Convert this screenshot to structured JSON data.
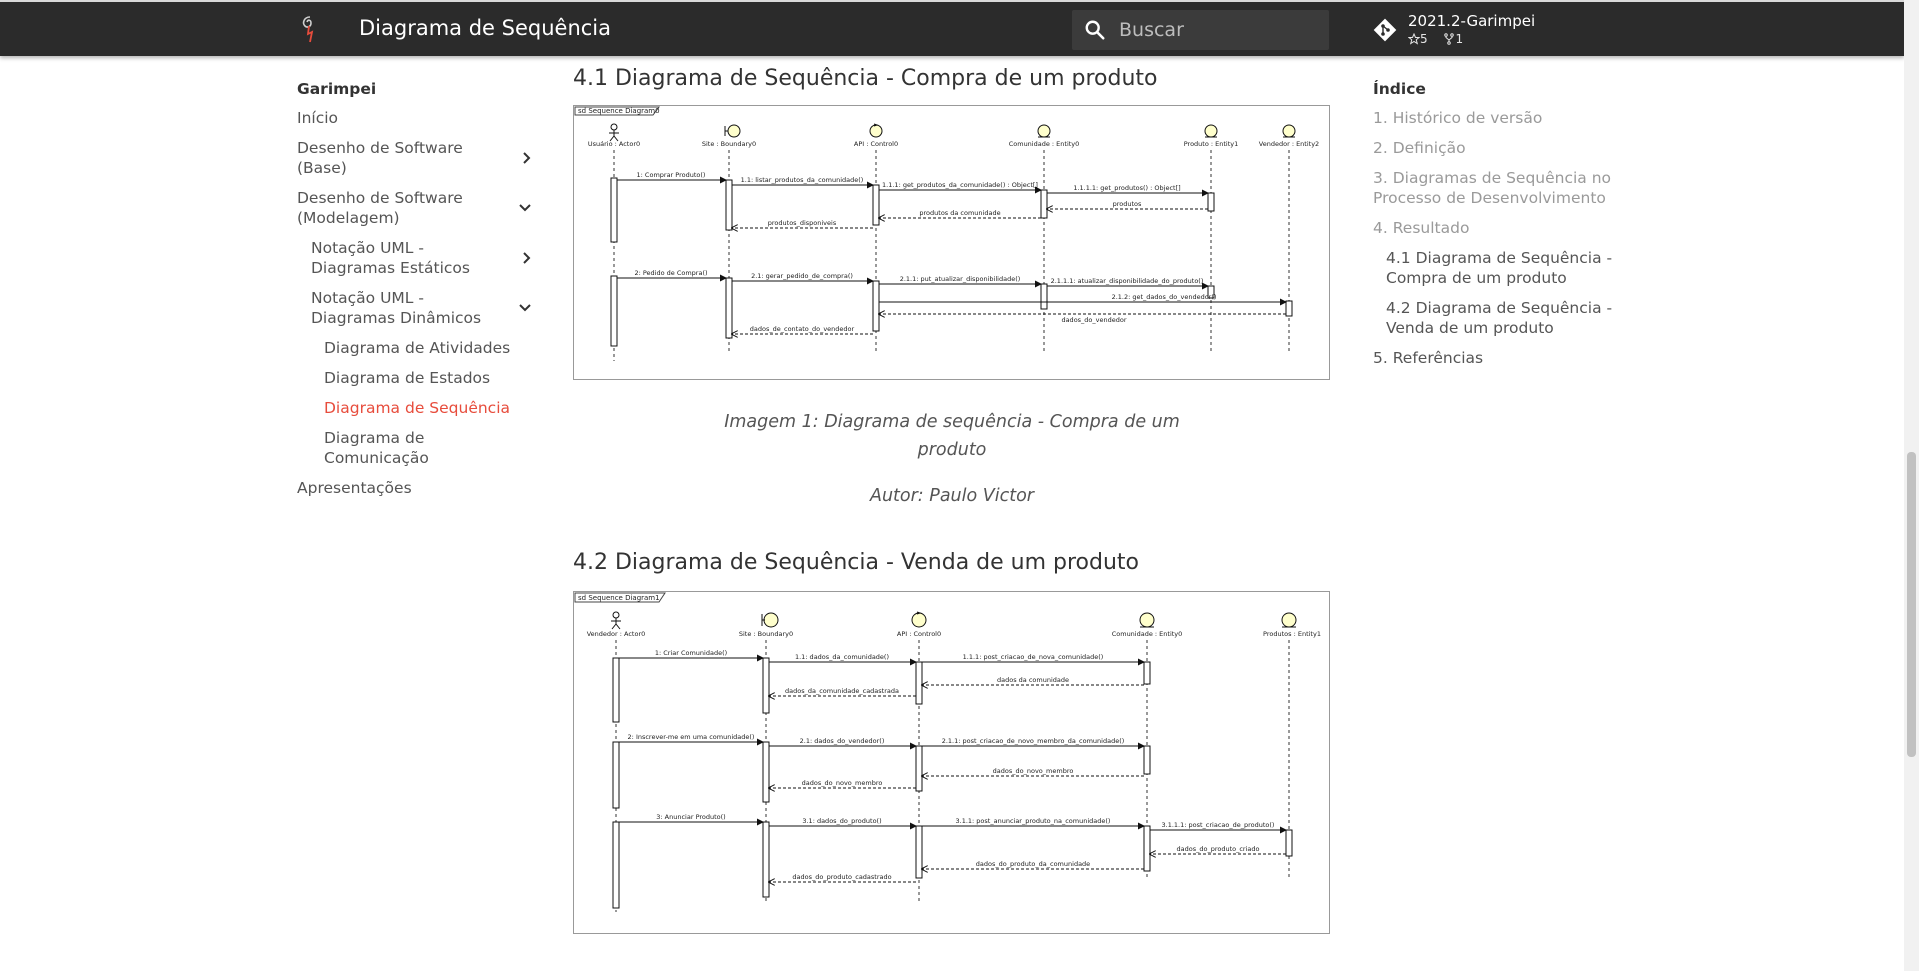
{
  "header": {
    "title": "Diagrama de Sequência",
    "search_placeholder": "Buscar",
    "repo_name": "2021.2-Garimpei",
    "stars": "5",
    "forks": "1"
  },
  "nav": {
    "brand": "Garimpei",
    "items": [
      {
        "label": "Início"
      },
      {
        "label": "Desenho de Software (Base)"
      },
      {
        "label": "Desenho de Software (Modelagem)"
      },
      {
        "label": "Notação UML - Diagramas Estáticos"
      },
      {
        "label": "Notação UML - Diagramas Dinâmicos"
      },
      {
        "label": "Diagrama de Atividades"
      },
      {
        "label": "Diagrama de Estados"
      },
      {
        "label": "Diagrama de Sequência"
      },
      {
        "label": "Diagrama de Comunicação"
      },
      {
        "label": "Apresentações"
      }
    ]
  },
  "main": {
    "section1_title": "4.1 Diagrama de Sequência - Compra de um produto",
    "caption1": "Imagem 1: Diagrama de sequência - Compra de um produto",
    "author1": "Autor: Paulo Victor",
    "section2_title": "4.2 Diagrama de Sequência - Venda de um produto"
  },
  "diagram1": {
    "frame": "sd Sequence Diagram0",
    "lifelines": [
      "Usuário : Actor0",
      "Site : Boundary0",
      "API : Control0",
      "Comunidade : Entity0",
      "Produto : Entity1",
      "Vendedor : Entity2"
    ],
    "messages": [
      "1: Comprar Produto()",
      "1.1: listar_produtos_da_comunidade()",
      "1.1.1: get_produtos_da_comunidade() : Object[]",
      "1.1.1.1: get_produtos() : Object[]",
      "produtos",
      "produtos da comunidade",
      "produtos_disponiveis",
      "2: Pedido de Compra()",
      "2.1: gerar_pedido_de_compra()",
      "2.1.1: put_atualizar_disponibilidade()",
      "2.1.1.1: atualizar_disponibilidade_do_produto()",
      "2.1.2: get_dados_do_vendedor()",
      "dados_do_vendedor",
      "dados_de_contato_do_vendedor"
    ]
  },
  "diagram2": {
    "frame": "sd Sequence Diagram1",
    "lifelines": [
      "Vendedor : Actor0",
      "Site : Boundary0",
      "API : Control0",
      "Comunidade : Entity0",
      "Produtos : Entity1"
    ],
    "messages": [
      "1: Criar Comunidade()",
      "1.1: dados_da_comunidade()",
      "1.1.1: post_criacao_de_nova_comunidade()",
      "dados da comunidade",
      "dados_da_comunidade_cadastrada",
      "2: Inscrever-me em uma comunidade()",
      "2.1: dados_do_vendedor()",
      "2.1.1: post_criacao_de_novo_membro_da_comunidade()",
      "dados_do_novo_membro",
      "dados_do_novo_membro",
      "3: Anunciar Produto()",
      "3.1: dados_do_produto()",
      "3.1.1: post_anunciar_produto_na_comunidade()",
      "3.1.1.1: post_criacao_de_produto()",
      "dados_do_produto_criado",
      "dados_do_produto_da_comunidade",
      "dados_do_produto_cadastrado"
    ]
  },
  "toc": {
    "title": "Índice",
    "items": [
      {
        "label": "1. Histórico de versão"
      },
      {
        "label": "2. Definição"
      },
      {
        "label": "3. Diagramas de Sequência no Processo de Desenvolvimento"
      },
      {
        "label": "4. Resultado"
      },
      {
        "label": "4.1 Diagrama de Sequência - Compra de um produto"
      },
      {
        "label": "4.2 Diagrama de Sequência - Venda de um produto"
      },
      {
        "label": "5. Referências"
      }
    ]
  },
  "colors": {
    "header_bg": "#2b2b2b",
    "accent": "#e74c3c"
  }
}
